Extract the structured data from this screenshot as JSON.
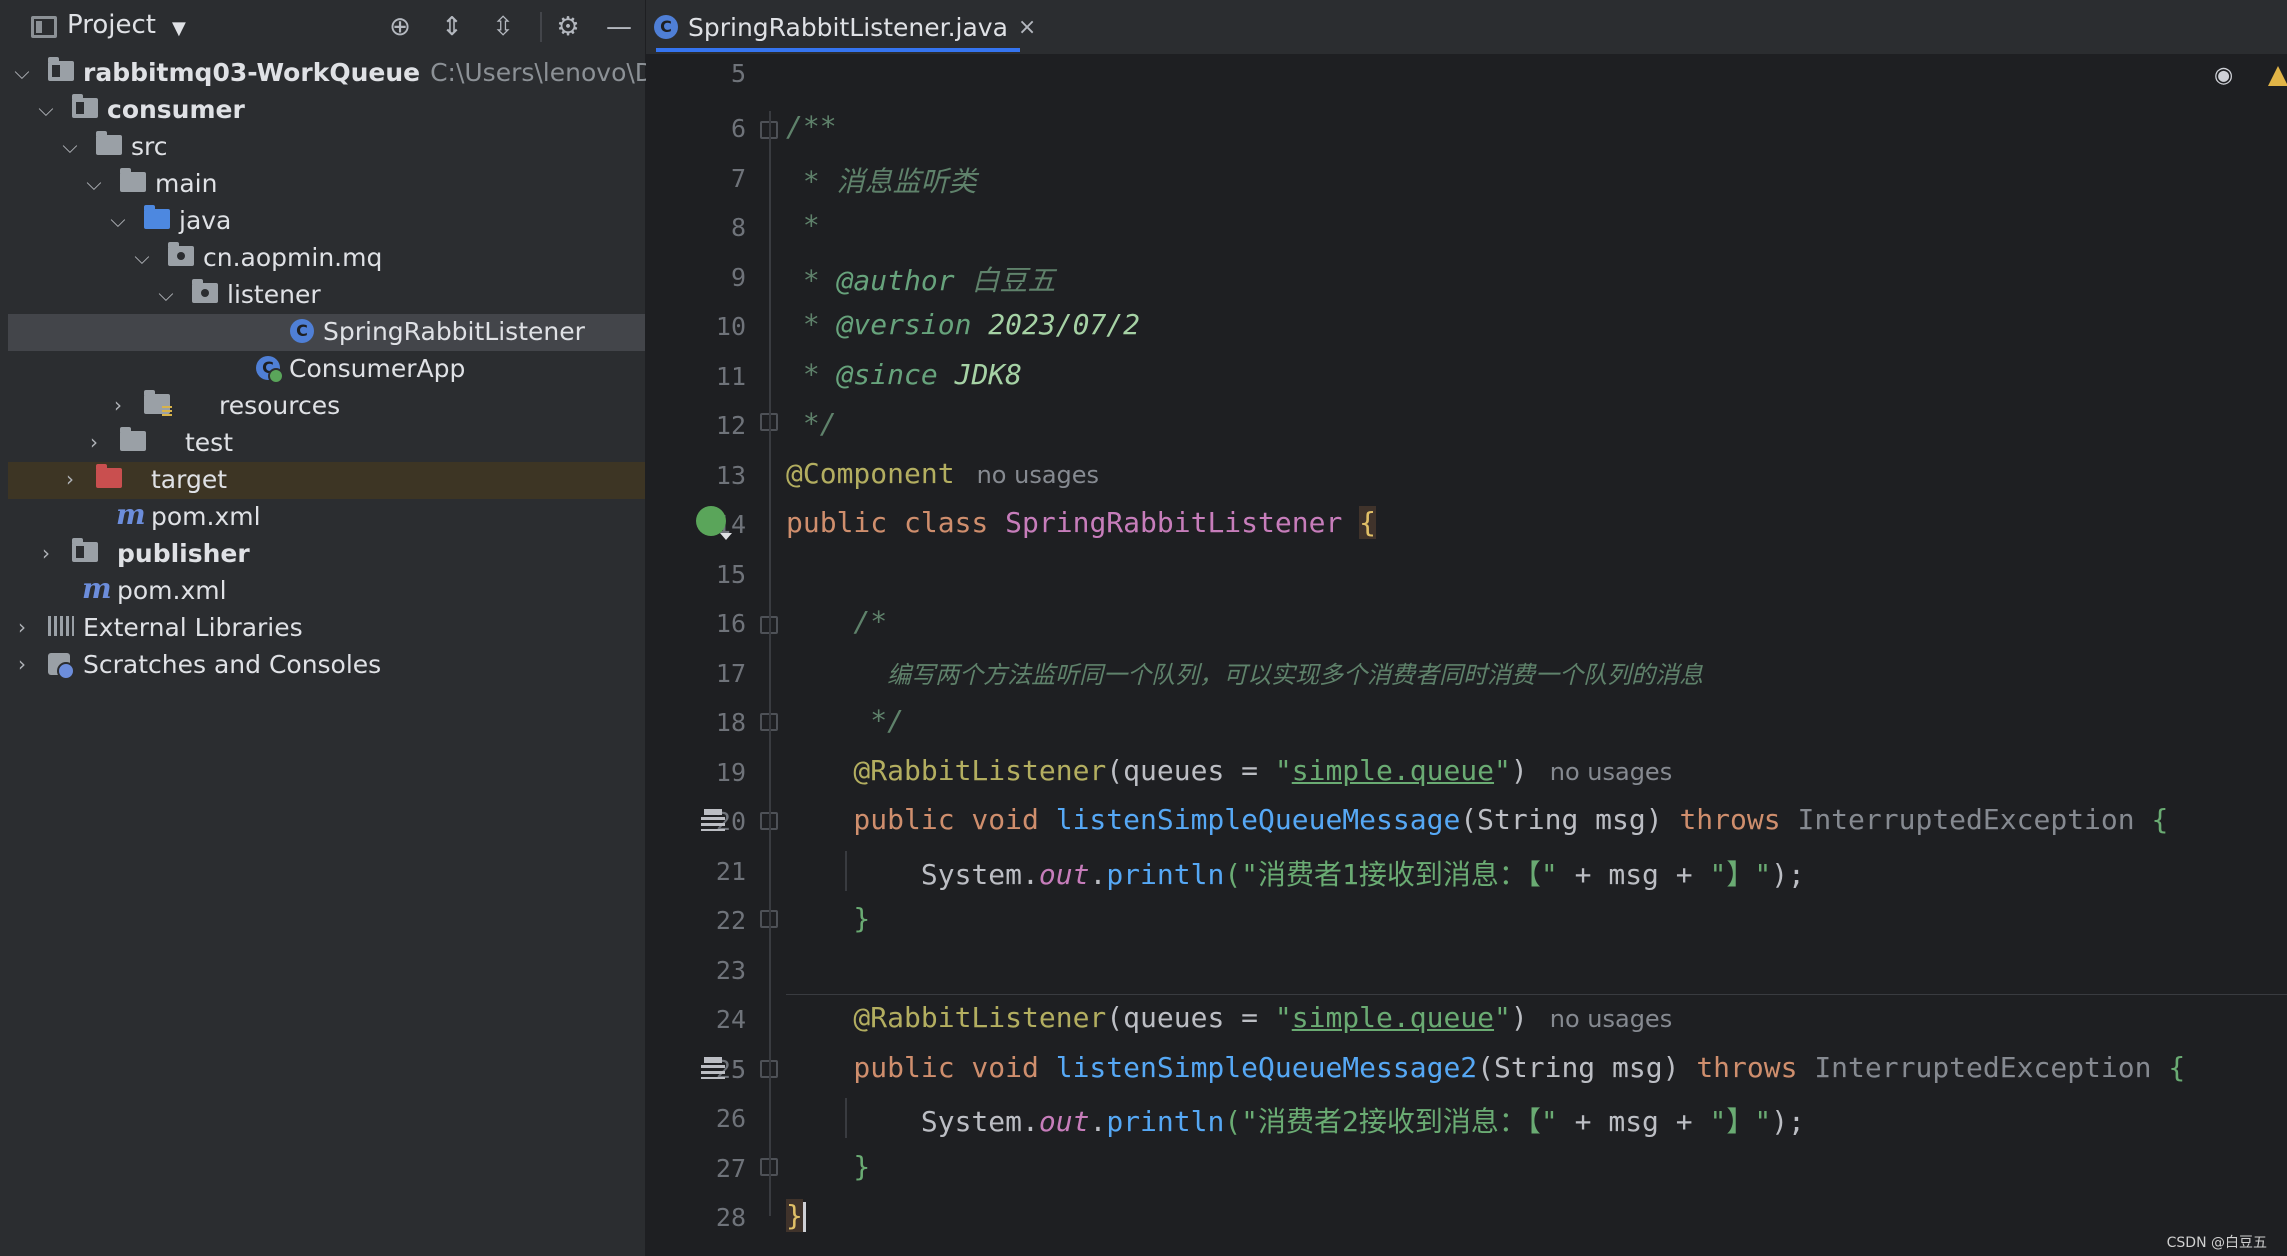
{
  "panel": {
    "title": "Project"
  },
  "tree": {
    "root_label": "rabbitmq03-WorkQueue",
    "root_path": "C:\\Users\\lenovo\\Desk",
    "consumer": "consumer",
    "src": "src",
    "main": "main",
    "java": "java",
    "package": "cn.aopmin.mq",
    "listener": "listener",
    "spring_rabbit_listener": "SpringRabbitListener",
    "consumer_app": "ConsumerApp",
    "resources": "resources",
    "test": "test",
    "target": "target",
    "pom_consumer": "pom.xml",
    "publisher": "publisher",
    "pom_root": "pom.xml",
    "external_libraries": "External Libraries",
    "scratches": "Scratches and Consoles"
  },
  "tab": {
    "label": "SpringRabbitListener.java",
    "close": "×"
  },
  "editor": {
    "line_numbers": [
      "5",
      "6",
      "7",
      "8",
      "9",
      "10",
      "11",
      "12",
      "13",
      "14",
      "15",
      "16",
      "17",
      "18",
      "19",
      "20",
      "21",
      "22",
      "23",
      "24",
      "25",
      "26",
      "27",
      "28"
    ],
    "l6": "/**",
    "l7_star": " * ",
    "l7_text": "消息监听类",
    "l8": " *",
    "l9_star": " * ",
    "l9_tag": "@author",
    "l9_val": " 白豆五",
    "l10_star": " * ",
    "l10_tag": "@version",
    "l10_val": " 2023/07/2",
    "l11_star": " * ",
    "l11_tag": "@since",
    "l11_val": " JDK8",
    "l12": " */",
    "l13_ann": "@Component",
    "no_usages": "no usages",
    "l14_kw": "public class ",
    "l14_name": "SpringRabbitListener",
    "l14_brace": "{",
    "l16": "    /*",
    "l17": "       编写两个方法监听同一个队列，可以实现多个消费者同时消费一个队列的消息",
    "l18": "     */",
    "l19_ann": "    @RabbitListener",
    "l19_a": "(queues = ",
    "l19_q1": "\"",
    "l19_link": "simple.queue",
    "l19_q2": "\"",
    "l19_b": ")",
    "l20_kw1": "    public void ",
    "l20_meth": "listenSimpleQueueMessage",
    "l20_params": "(String msg) ",
    "l20_throws": "throws ",
    "l20_ex": "InterruptedException ",
    "brace_open": "{",
    "l21_sys": "        System.",
    "l21_out": "out",
    "l21_dot": ".",
    "l21_println": "println",
    "l21_str1": "(\"消费者1接收到消息：【\"",
    "l21_mid": " + msg + ",
    "l21_str2": "\"】\"",
    "l21_end": ");",
    "l22": "    }",
    "l24_ann": "    @RabbitListener",
    "l25_meth": "listenSimpleQueueMessage2",
    "l26_str1": "(\"消费者2接收到消息：【\"",
    "l28": "}"
  },
  "watermark": "CSDN @白豆五"
}
